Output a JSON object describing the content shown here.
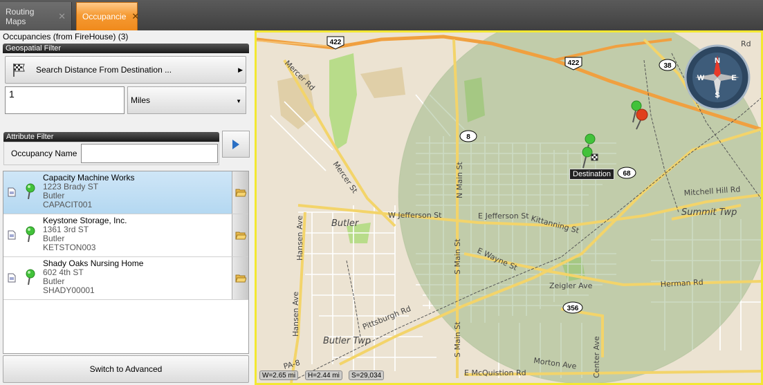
{
  "tabs": [
    {
      "label": "Routing Maps",
      "active": false
    },
    {
      "label": "Occupancie",
      "active": true
    }
  ],
  "panel": {
    "title": "Occupancies (from FireHouse) (3)",
    "geo_filter_header": "Geospatial Filter",
    "search_button_label": "Search  Distance From Destination ...",
    "distance_value": "1",
    "distance_unit": "Miles",
    "attr_filter_header": "Attribute Filter",
    "occupancy_name_label": "Occupancy Name",
    "occupancy_name_value": "",
    "switch_button_label": "Switch to Advanced"
  },
  "occupancies": [
    {
      "name": "Capacity Machine Works",
      "address": "1223 Brady ST",
      "city": "Butler",
      "code": "CAPACIT001",
      "selected": true
    },
    {
      "name": "Keystone Storage, Inc.",
      "address": "1361 3rd ST",
      "city": "Butler",
      "code": "KETSTON003",
      "selected": false
    },
    {
      "name": "Shady Oaks Nursing Home",
      "address": "602 4th ST",
      "city": "Butler",
      "code": "SHADY00001",
      "selected": false
    }
  ],
  "map": {
    "destination_label": "Destination",
    "status": {
      "width": "W=2.65 mi",
      "height": "H=2.44 mi",
      "scale": "S=29,034"
    },
    "compass": {
      "n": "N",
      "s": "S",
      "e": "E",
      "w": "W"
    },
    "shields": [
      "422",
      "422",
      "38",
      "8",
      "68",
      "356"
    ],
    "streets": [
      "Mercer Rd",
      "Mercer St",
      "N Main St",
      "W Jefferson St",
      "E Jefferson St",
      "Kittanning St",
      "Butler",
      "Hansen Ave",
      "Hansen Ave",
      "E Wayne St",
      "Zeigler Ave",
      "Herman Rd",
      "Mitchell Hill Rd",
      "Summit Twp",
      "Pittsburgh Rd",
      "S Main St",
      "S Main St",
      "Butler Twp",
      "PA-8",
      "Morton Ave",
      "Center Ave",
      "E McQuistion Rd",
      "Rd"
    ],
    "colors": {
      "radius_fill": "#8fb07a",
      "highway": "#f0a040",
      "road": "#f3d46a",
      "background": "#ece3d2",
      "park": "#b8dc8a"
    }
  }
}
